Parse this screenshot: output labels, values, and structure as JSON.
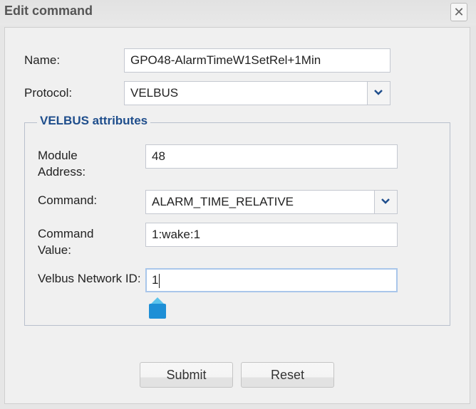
{
  "dialog": {
    "title": "Edit command",
    "close_icon": "close-icon"
  },
  "form": {
    "name_label": "Name:",
    "name_value": "GPO48-AlarmTimeW1SetRel+1Min",
    "protocol_label": "Protocol:",
    "protocol_value": "VELBUS",
    "attributes_legend": "VELBUS attributes",
    "module_address_label": "Module Address:",
    "module_address_value": "48",
    "command_label": "Command:",
    "command_value": "ALARM_TIME_RELATIVE",
    "command_value_label": "Command Value:",
    "command_value_value": "1:wake:1",
    "network_id_label": "Velbus Network ID:",
    "network_id_value": "1"
  },
  "buttons": {
    "submit": "Submit",
    "reset": "Reset"
  },
  "colors": {
    "accent": "#1f4e8c",
    "marker": "#1e8fd6"
  }
}
